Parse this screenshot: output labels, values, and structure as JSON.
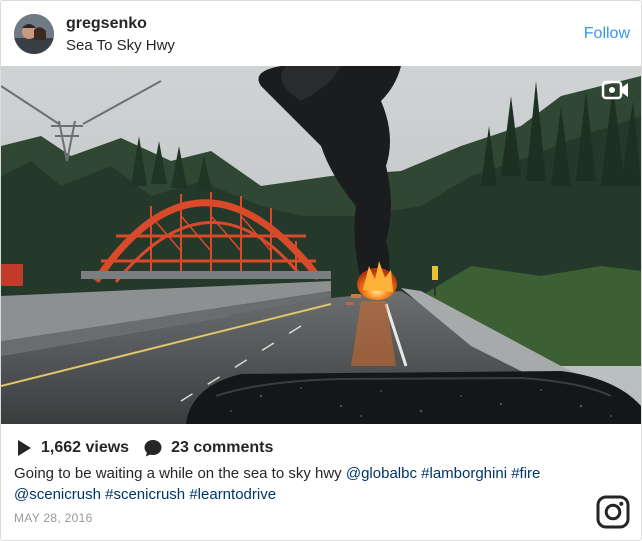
{
  "post": {
    "username": "gregsenko",
    "location": "Sea To Sky Hwy",
    "follow_label": "Follow",
    "views": "1,662 views",
    "comments": "23 comments",
    "caption": {
      "text": "Going to be waiting a while on the sea to sky hwy ",
      "mention": "@globalbc",
      "tags": [
        "#lamborghini",
        "#fire",
        "@scenicrush",
        "#scenicrush",
        "#learntodrive"
      ]
    },
    "date": "MAY 28, 2016"
  },
  "icons": {
    "video": "video-camera-icon",
    "views": "play-icon",
    "comments": "comment-bubble-icon",
    "brand": "instagram-logo"
  },
  "colors": {
    "accent": "#3897f0",
    "link": "#003569",
    "text": "#262626",
    "muted": "#999999",
    "border": "#dbdbdb",
    "bridge": "#d94a2b",
    "fire": "#ff7a1a"
  }
}
